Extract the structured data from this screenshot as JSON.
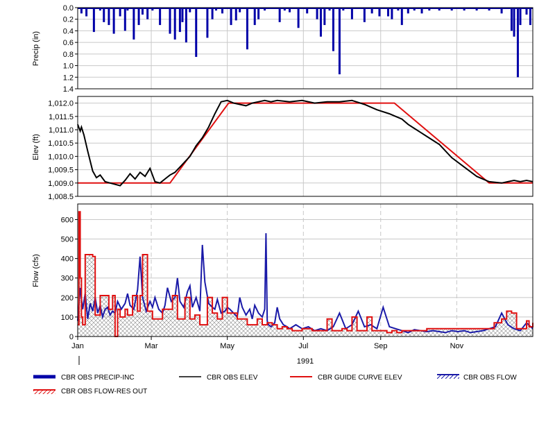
{
  "colors": {
    "precip": "#0000a8",
    "elev": "#000000",
    "guide": "#e01010",
    "flow": "#1a1aa8",
    "flow_out": "#e01010",
    "grid": "#c8c8c8"
  },
  "chart_data": [
    {
      "type": "bar",
      "ylabel": "Precip (in)",
      "ylim": [
        1.4,
        0.0
      ],
      "y_inverted": true,
      "yticks": [
        "0.0",
        "0.2",
        "0.4",
        "0.6",
        "0.8",
        "1.0",
        "1.2",
        "1.4"
      ],
      "series": [
        {
          "name": "CBR OBS PRECIP-INC",
          "x_day": [
            3,
            7,
            13,
            18,
            21,
            25,
            29,
            34,
            38,
            40,
            45,
            49,
            52,
            56,
            60,
            66,
            74,
            78,
            82,
            84,
            87,
            90,
            95,
            104,
            108,
            111,
            116,
            123,
            127,
            130,
            136,
            142,
            145,
            150,
            162,
            166,
            170,
            177,
            184,
            192,
            195,
            198,
            202,
            205,
            210,
            213,
            220,
            230,
            236,
            242,
            249,
            252,
            257,
            260,
            265,
            270,
            276,
            282,
            290,
            300,
            310,
            320,
            330,
            340,
            348,
            350,
            353,
            355,
            360,
            363
          ],
          "values": [
            0.1,
            0.15,
            0.42,
            0.05,
            0.25,
            0.3,
            0.45,
            0.15,
            0.4,
            0.05,
            0.55,
            0.3,
            0.12,
            0.2,
            0.05,
            0.3,
            0.45,
            0.55,
            0.42,
            0.25,
            0.6,
            0.08,
            0.85,
            0.52,
            0.2,
            0.05,
            0.1,
            0.3,
            0.22,
            0.08,
            0.72,
            0.3,
            0.2,
            0.05,
            0.25,
            0.05,
            0.08,
            0.35,
            0.1,
            0.2,
            0.5,
            0.3,
            0.05,
            0.75,
            1.15,
            0.05,
            0.2,
            0.25,
            0.1,
            0.15,
            0.15,
            0.2,
            0.05,
            0.3,
            0.1,
            0.05,
            0.1,
            0.05,
            0.05,
            0.05,
            0.05,
            0.05,
            0.05,
            0.1,
            0.4,
            0.5,
            1.2,
            0.3,
            0.12,
            0.3
          ]
        }
      ]
    },
    {
      "type": "line",
      "ylabel": "Elev (ft)",
      "ylim": [
        1008.5,
        1012.25
      ],
      "yticks": [
        "1,008.5",
        "1,009.0",
        "1,009.5",
        "1,010.0",
        "1,010.5",
        "1,011.0",
        "1,011.5",
        "1,012.0"
      ],
      "series": [
        {
          "name": "CBR OBS ELEV",
          "x_day": [
            0,
            2,
            3,
            5,
            8,
            12,
            15,
            18,
            22,
            26,
            30,
            34,
            38,
            42,
            46,
            50,
            54,
            58,
            62,
            66,
            70,
            74,
            78,
            82,
            86,
            90,
            95,
            100,
            105,
            110,
            115,
            120,
            125,
            130,
            135,
            140,
            145,
            150,
            155,
            160,
            170,
            180,
            190,
            200,
            210,
            220,
            230,
            240,
            250,
            255,
            260,
            265,
            270,
            275,
            280,
            285,
            290,
            295,
            300,
            310,
            320,
            330,
            340,
            345,
            350,
            355,
            360,
            365
          ],
          "values": [
            1011.2,
            1010.95,
            1011.1,
            1010.8,
            1010.2,
            1009.45,
            1009.2,
            1009.3,
            1009.05,
            1009.0,
            1008.95,
            1008.9,
            1009.1,
            1009.35,
            1009.15,
            1009.4,
            1009.25,
            1009.55,
            1009.05,
            1009.0,
            1009.15,
            1009.3,
            1009.4,
            1009.6,
            1009.8,
            1010.0,
            1010.4,
            1010.7,
            1011.1,
            1011.6,
            1012.05,
            1012.1,
            1012.0,
            1011.95,
            1011.9,
            1012.0,
            1012.05,
            1012.1,
            1012.05,
            1012.1,
            1012.05,
            1012.1,
            1012.0,
            1012.05,
            1012.05,
            1012.1,
            1011.95,
            1011.75,
            1011.6,
            1011.5,
            1011.4,
            1011.2,
            1011.05,
            1010.9,
            1010.75,
            1010.6,
            1010.45,
            1010.2,
            1009.95,
            1009.6,
            1009.25,
            1009.05,
            1009.0,
            1009.05,
            1009.1,
            1009.05,
            1009.1,
            1009.05
          ]
        },
        {
          "name": "CBR GUIDE CURVE ELEV",
          "x_day": [
            0,
            74,
            121,
            243,
            254,
            330,
            365
          ],
          "values": [
            1009.0,
            1009.0,
            1012.0,
            1012.0,
            1012.0,
            1009.0,
            1009.0
          ]
        }
      ]
    },
    {
      "type": "line",
      "ylabel": "Flow (cfs)",
      "xlabel": "1991",
      "ylim": [
        0,
        680
      ],
      "yticks": [
        "0",
        "100",
        "200",
        "300",
        "400",
        "500",
        "600"
      ],
      "xticks": [
        "Jan",
        "Mar",
        "May",
        "Jul",
        "Sep",
        "Nov"
      ],
      "xtick_day": [
        0,
        59,
        120,
        181,
        243,
        304
      ],
      "series": [
        {
          "name": "CBR OBS FLOW",
          "x_day": [
            0,
            2,
            4,
            6,
            8,
            10,
            12,
            14,
            16,
            18,
            20,
            22,
            24,
            26,
            28,
            30,
            32,
            35,
            38,
            40,
            42,
            45,
            48,
            50,
            52,
            55,
            58,
            60,
            62,
            65,
            68,
            70,
            72,
            75,
            78,
            80,
            82,
            85,
            88,
            90,
            92,
            95,
            98,
            100,
            102,
            105,
            108,
            110,
            112,
            115,
            118,
            120,
            122,
            125,
            128,
            130,
            132,
            135,
            138,
            140,
            142,
            145,
            148,
            150,
            151,
            152,
            153,
            155,
            158,
            160,
            162,
            165,
            168,
            170,
            175,
            180,
            185,
            190,
            195,
            200,
            205,
            210,
            215,
            220,
            225,
            230,
            235,
            240,
            245,
            250,
            255,
            260,
            265,
            270,
            275,
            280,
            285,
            290,
            295,
            300,
            305,
            310,
            315,
            320,
            325,
            330,
            335,
            340,
            345,
            350,
            355,
            360,
            365
          ],
          "values": [
            80,
            250,
            140,
            220,
            90,
            170,
            130,
            200,
            120,
            160,
            100,
            140,
            150,
            110,
            130,
            120,
            180,
            140,
            170,
            220,
            160,
            140,
            240,
            410,
            200,
            130,
            180,
            150,
            200,
            140,
            120,
            160,
            250,
            180,
            200,
            300,
            180,
            150,
            230,
            260,
            150,
            200,
            130,
            470,
            280,
            170,
            150,
            140,
            190,
            120,
            130,
            150,
            140,
            120,
            100,
            200,
            150,
            110,
            140,
            90,
            160,
            120,
            100,
            140,
            530,
            80,
            60,
            50,
            70,
            150,
            90,
            60,
            50,
            40,
            60,
            40,
            50,
            30,
            40,
            30,
            50,
            120,
            40,
            60,
            130,
            50,
            60,
            40,
            150,
            50,
            40,
            30,
            20,
            35,
            30,
            25,
            30,
            25,
            20,
            30,
            25,
            30,
            20,
            25,
            30,
            40,
            50,
            120,
            60,
            40,
            30,
            70,
            40
          ]
        },
        {
          "name": "CBR OBS FLOW-RES OUT",
          "x_day": [
            0,
            1,
            2,
            3,
            4,
            6,
            8,
            12,
            14,
            18,
            22,
            25,
            28,
            30,
            32,
            34,
            38,
            40,
            44,
            48,
            50,
            52,
            56,
            60,
            64,
            68,
            72,
            76,
            80,
            84,
            86,
            90,
            94,
            98,
            100,
            104,
            108,
            112,
            116,
            120,
            124,
            128,
            132,
            136,
            140,
            144,
            148,
            152,
            156,
            160,
            164,
            168,
            172,
            176,
            180,
            188,
            196,
            200,
            204,
            208,
            212,
            216,
            220,
            224,
            228,
            232,
            236,
            240,
            244,
            248,
            252,
            256,
            260,
            264,
            268,
            280,
            300,
            320,
            330,
            334,
            340,
            344,
            348,
            352,
            356,
            360,
            362,
            365
          ],
          "values": [
            60,
            640,
            300,
            100,
            60,
            420,
            420,
            410,
            110,
            210,
            210,
            140,
            210,
            0,
            140,
            100,
            140,
            110,
            210,
            130,
            210,
            420,
            130,
            90,
            90,
            140,
            140,
            210,
            90,
            90,
            200,
            90,
            110,
            60,
            60,
            200,
            120,
            90,
            200,
            120,
            120,
            90,
            90,
            60,
            60,
            90,
            60,
            70,
            60,
            40,
            50,
            40,
            30,
            30,
            40,
            30,
            30,
            90,
            30,
            30,
            40,
            30,
            100,
            30,
            30,
            100,
            30,
            30,
            30,
            20,
            30,
            20,
            30,
            30,
            30,
            40,
            40,
            40,
            40,
            70,
            90,
            130,
            120,
            40,
            40,
            80,
            50,
            70
          ]
        }
      ]
    }
  ],
  "legend": {
    "items": [
      {
        "label": "CBR OBS PRECIP-INC",
        "style": "bar"
      },
      {
        "label": "CBR OBS ELEV",
        "style": "line-black"
      },
      {
        "label": "CBR GUIDE CURVE ELEV",
        "style": "line-red"
      },
      {
        "label": "CBR OBS FLOW",
        "style": "line-blue-hatch"
      },
      {
        "label": "CBR OBS FLOW-RES OUT",
        "style": "line-red-hatch"
      }
    ]
  }
}
